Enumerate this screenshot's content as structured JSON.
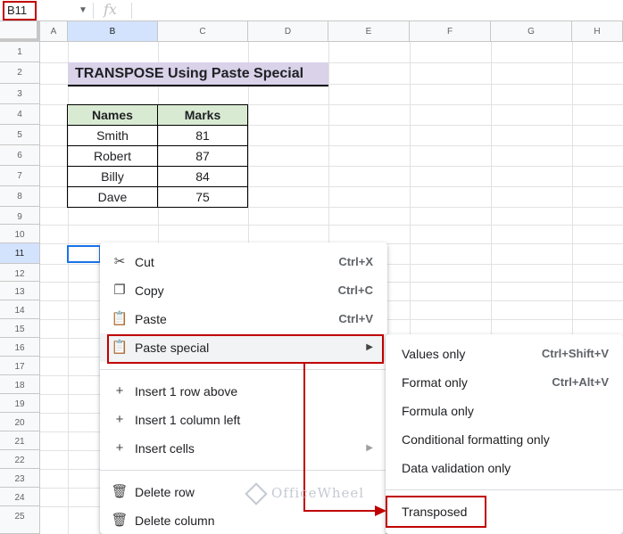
{
  "formula_bar": {
    "name_box": "B11",
    "fx": "fx"
  },
  "columns": [
    "A",
    "B",
    "C",
    "D",
    "E",
    "F",
    "G",
    "H"
  ],
  "rows": [
    "1",
    "2",
    "3",
    "4",
    "5",
    "6",
    "7",
    "8",
    "9",
    "10",
    "11",
    "12",
    "13",
    "14",
    "15",
    "16",
    "17",
    "18",
    "19",
    "20",
    "21",
    "22",
    "23",
    "24",
    "25"
  ],
  "sheet": {
    "title": "TRANSPOSE Using Paste Special",
    "table": {
      "headers": [
        "Names",
        "Marks"
      ],
      "rows": [
        [
          "Smith",
          "81"
        ],
        [
          "Robert",
          "87"
        ],
        [
          "Billy",
          "84"
        ],
        [
          "Dave",
          "75"
        ]
      ]
    }
  },
  "context_menu": {
    "items": [
      {
        "label": "Cut",
        "shortcut": "Ctrl+X",
        "icon": "scissors-icon"
      },
      {
        "label": "Copy",
        "shortcut": "Ctrl+C",
        "icon": "copy-icon"
      },
      {
        "label": "Paste",
        "shortcut": "Ctrl+V",
        "icon": "clipboard-icon"
      },
      {
        "label": "Paste special",
        "icon": "clipboard-icon"
      },
      {
        "label": "Insert 1 row above",
        "icon": "plus-icon"
      },
      {
        "label": "Insert 1 column left",
        "icon": "plus-icon"
      },
      {
        "label": "Insert cells",
        "icon": "plus-icon"
      },
      {
        "label": "Delete row",
        "icon": "trash-icon"
      },
      {
        "label": "Delete column",
        "icon": "trash-icon"
      }
    ]
  },
  "paste_special_menu": {
    "items": [
      {
        "label": "Values only",
        "shortcut": "Ctrl+Shift+V"
      },
      {
        "label": "Format only",
        "shortcut": "Ctrl+Alt+V"
      },
      {
        "label": "Formula only"
      },
      {
        "label": "Conditional formatting only"
      },
      {
        "label": "Data validation only"
      },
      {
        "label": "Transposed"
      }
    ]
  },
  "watermark": "OfficeWheel",
  "colors": {
    "accent_red": "#c00000",
    "selection_blue": "#1a73e8",
    "title_bg": "#d9d2e9",
    "header_bg": "#d9ead3"
  }
}
